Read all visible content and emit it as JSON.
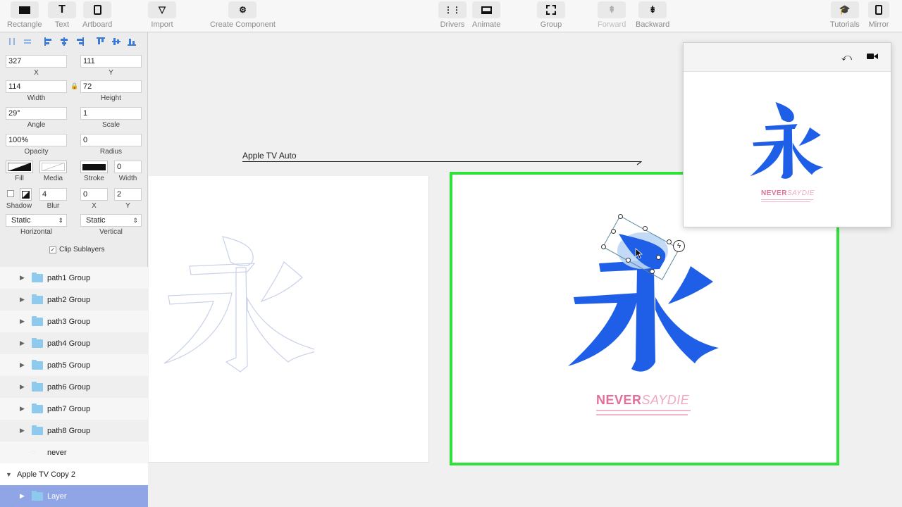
{
  "toolbar": {
    "items": [
      {
        "label": "Rectangle",
        "icon": "rectangle-icon"
      },
      {
        "label": "Text",
        "icon": "text-icon"
      },
      {
        "label": "Artboard",
        "icon": "artboard-icon"
      },
      {
        "label": "Import",
        "icon": "import-icon"
      },
      {
        "label": "Create Component",
        "icon": "component-icon"
      },
      {
        "label": "Drivers",
        "icon": "drivers-icon"
      },
      {
        "label": "Animate",
        "icon": "animate-icon"
      },
      {
        "label": "Group",
        "icon": "group-icon"
      },
      {
        "label": "Forward",
        "icon": "forward-icon"
      },
      {
        "label": "Backward",
        "icon": "backward-icon"
      },
      {
        "label": "Tutorials",
        "icon": "tutorials-icon"
      },
      {
        "label": "Mirror",
        "icon": "mirror-icon"
      }
    ]
  },
  "inspector": {
    "x": "327",
    "x_label": "X",
    "y": "111",
    "y_label": "Y",
    "width": "114",
    "width_label": "Width",
    "height": "72",
    "height_label": "Height",
    "angle": "29°",
    "angle_label": "Angle",
    "scale": "1",
    "scale_label": "Scale",
    "opacity": "100%",
    "opacity_label": "Opacity",
    "radius": "0",
    "radius_label": "Radius",
    "fill_label": "Fill",
    "media_label": "Media",
    "stroke_label": "Stroke",
    "stroke_width": "0",
    "stroke_width_label": "Width",
    "shadow_label": "Shadow",
    "blur": "4",
    "blur_label": "Blur",
    "shadow_x": "0",
    "shadow_x_label": "X",
    "shadow_y": "2",
    "shadow_y_label": "Y",
    "horizontal": "Static",
    "horizontal_label": "Horizontal",
    "vertical": "Static",
    "vertical_label": "Vertical",
    "clip_label": "Clip Sublayers"
  },
  "layers": {
    "items": [
      {
        "name": "path1 Group"
      },
      {
        "name": "path2 Group"
      },
      {
        "name": "path3 Group"
      },
      {
        "name": "path4 Group"
      },
      {
        "name": "path5 Group"
      },
      {
        "name": "path6 Group"
      },
      {
        "name": "path7 Group"
      },
      {
        "name": "path8 Group"
      },
      {
        "name": "never"
      },
      {
        "name": "Apple TV Copy 2"
      },
      {
        "name": "Layer"
      }
    ]
  },
  "canvas": {
    "connection_label": "Apple TV Auto",
    "glyph": "永",
    "brand_bold": "NEVER",
    "brand_light": "SAYDIE"
  },
  "colors": {
    "accent_blue": "#1f5fe8",
    "selection_green": "#2fe23a",
    "brand_pink": "#e0709a"
  }
}
